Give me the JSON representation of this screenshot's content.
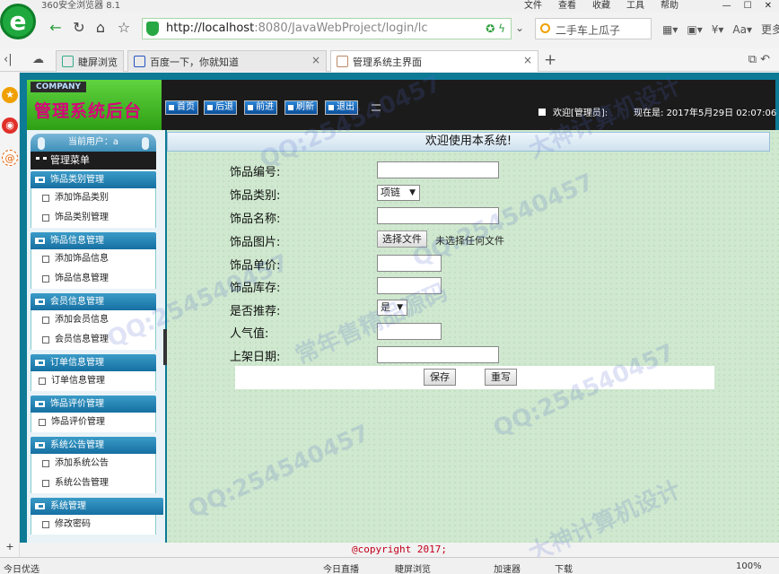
{
  "browser": {
    "app_title": "360安全浏览器 8.1",
    "menu": [
      "文件",
      "查看",
      "收藏",
      "工具",
      "帮助"
    ],
    "url_host": "http://localhost",
    "url_rest": ":8080/JavaWebProject/login/lc",
    "search_text": "二手车上瓜子",
    "more_label": "更多",
    "tabs": [
      {
        "label": "睫屏浏览"
      },
      {
        "label": "百度一下，你就知道"
      },
      {
        "label": "管理系统主界面"
      }
    ]
  },
  "header": {
    "company": "COMPANY",
    "system_title": "管理系统后台",
    "nav_buttons": [
      "首页",
      "后退",
      "前进",
      "刷新",
      "退出"
    ],
    "welcome": "欢迎[管理员]:",
    "time_label": "现在是:",
    "time_value": "2017年5月29日 02:07:06"
  },
  "sidebar": {
    "current_user_label": "当前用户：a",
    "menu_header": "管理菜单",
    "groups": [
      {
        "title": "饰品类别管理",
        "items": [
          "添加饰品类别",
          "饰品类别管理"
        ]
      },
      {
        "title": "饰品信息管理",
        "items": [
          "添加饰品信息",
          "饰品信息管理"
        ]
      },
      {
        "title": "会员信息管理",
        "items": [
          "添加会员信息",
          "会员信息管理"
        ]
      },
      {
        "title": "订单信息管理",
        "items": [
          "订单信息管理"
        ]
      },
      {
        "title": "饰品评价管理",
        "items": [
          "饰品评价管理"
        ]
      },
      {
        "title": "系统公告管理",
        "items": [
          "添加系统公告",
          "系统公告管理"
        ]
      },
      {
        "title": "系统管理",
        "items": [
          "修改密码"
        ]
      }
    ]
  },
  "content": {
    "title": "欢迎使用本系统!",
    "form": {
      "labels": [
        "饰品编号:",
        "饰品类别:",
        "饰品名称:",
        "饰品图片:",
        "饰品单价:",
        "饰品库存:",
        "是否推荐:",
        "人气值:",
        "上架日期:"
      ],
      "category_selected": "项链",
      "recommend_selected": "是",
      "file_button": "选择文件",
      "file_status": "未选择任何文件",
      "save": "保存",
      "reset": "重写"
    }
  },
  "footer": "@copyright 2017;",
  "statusbar": {
    "left": "今日优选",
    "items": [
      "今日直播",
      "睫屏浏览",
      "加速器",
      "下载"
    ],
    "zoom": "100%"
  },
  "watermarks": [
    "QQ:254540457",
    "大神计算机设计",
    "常年售精品源码"
  ],
  "colors": {
    "accent": "#0d7a96",
    "brand_title": "#d8007a",
    "footer": "#c0001a"
  }
}
